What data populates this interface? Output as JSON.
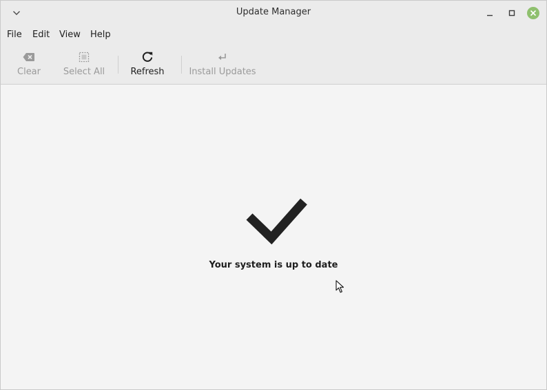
{
  "window": {
    "title": "Update Manager"
  },
  "menubar": {
    "items": [
      "File",
      "Edit",
      "View",
      "Help"
    ]
  },
  "toolbar": {
    "clear_label": "Clear",
    "select_all_label": "Select All",
    "refresh_label": "Refresh",
    "install_label": "Install Updates"
  },
  "main": {
    "status_text": "Your system is up to date"
  },
  "icons": {
    "window_menu": "chevron-down-icon",
    "minimize": "minimize-icon",
    "maximize": "maximize-icon",
    "close": "close-icon",
    "clear": "backspace-icon",
    "select_all": "select-all-icon",
    "refresh": "refresh-icon",
    "install": "enter-arrow-icon",
    "status": "checkmark-icon"
  },
  "colors": {
    "close_button": "#8fc06e",
    "disabled_text": "#9a9a9a",
    "text": "#1e1e1e"
  }
}
